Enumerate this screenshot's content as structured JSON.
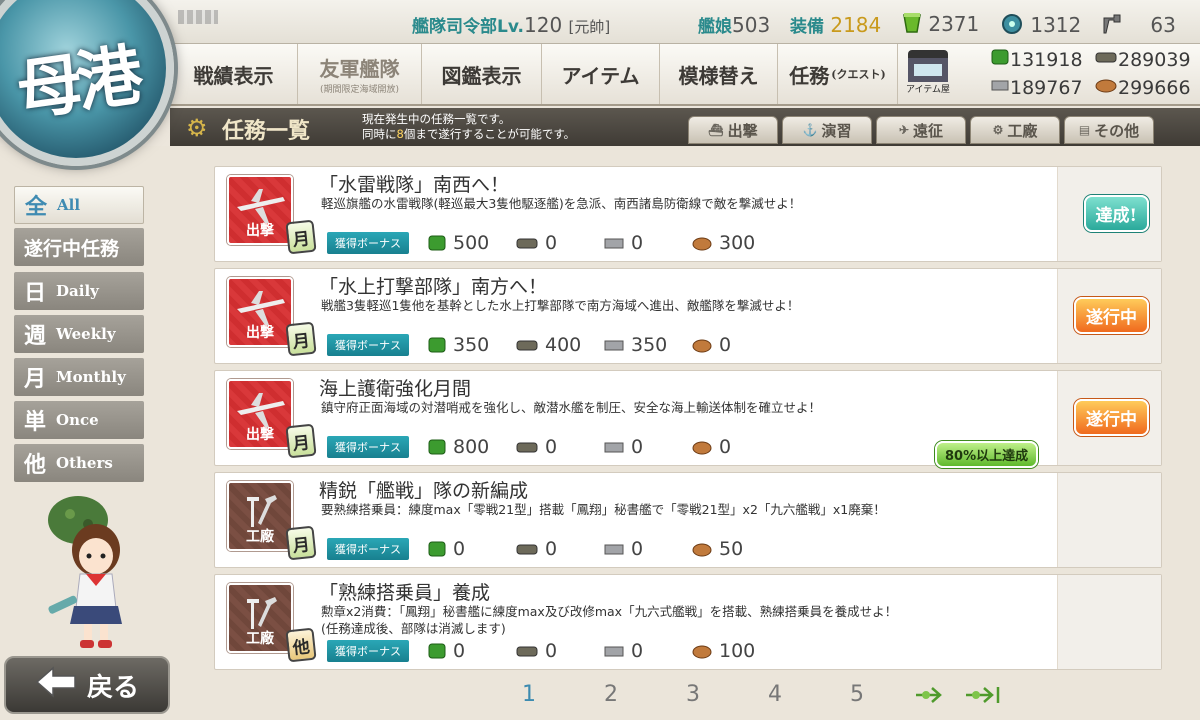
{
  "header": {
    "rank_label": "艦隊司令部Lv.",
    "level": "120",
    "rank_title": "[元帥]",
    "ships_label": "艦娘",
    "ships": "503",
    "equip_label": "装備",
    "equip": "2184",
    "bucket": "2371",
    "devmat": "1312",
    "screws": "63"
  },
  "badge": {
    "text": "母港"
  },
  "nav": {
    "record": "戦績表示",
    "friend_fleet": "友軍艦隊",
    "friend_fleet_sub": "(期間限定海域開放)",
    "album": "図鑑表示",
    "items": "アイテム",
    "remodel": "模様替え",
    "quest": "任務",
    "quest_sub": "(クエスト)",
    "shop": "アイテム屋"
  },
  "materials": {
    "fuel": "131918",
    "ammo": "289039",
    "steel": "189767",
    "bauxite": "299666"
  },
  "subheader": {
    "title": "任務一覧",
    "desc1": "現在発生中の任務一覧です。",
    "desc2_a": "同時に",
    "desc2_num": "8",
    "desc2_b": "個まで遂行することが可能です。"
  },
  "categories": [
    {
      "label": "出撃"
    },
    {
      "label": "演習"
    },
    {
      "label": "遠征"
    },
    {
      "label": "工廠"
    },
    {
      "label": "その他"
    }
  ],
  "filters": [
    {
      "k": "全",
      "label": "All"
    },
    {
      "k": "",
      "label": "遂行中任務"
    },
    {
      "k": "日",
      "label": "Daily"
    },
    {
      "k": "週",
      "label": "Weekly"
    },
    {
      "k": "月",
      "label": "Monthly"
    },
    {
      "k": "単",
      "label": "Once"
    },
    {
      "k": "他",
      "label": "Others"
    }
  ],
  "bonus_label": "獲得ボーナス",
  "quests": [
    {
      "cat": "出撃",
      "freq": "月",
      "title": "「水雷戦隊」南西へ！",
      "desc": "軽巡旗艦の水雷戦隊(軽巡最大3隻他駆逐艦)を急派、南西諸島防衛線で敵を撃滅せよ！",
      "desc2": "",
      "fuel": "500",
      "ammo": "0",
      "steel": "0",
      "bauxite": "300",
      "status": "達成!"
    },
    {
      "cat": "出撃",
      "freq": "月",
      "title": "「水上打撃部隊」南方へ！",
      "desc": "戦艦3隻軽巡1隻他を基幹とした水上打撃部隊で南方海域へ進出、敵艦隊を撃滅せよ！",
      "desc2": "",
      "fuel": "350",
      "ammo": "400",
      "steel": "350",
      "bauxite": "0",
      "status": "遂行中"
    },
    {
      "cat": "出撃",
      "freq": "月",
      "title": "海上護衛強化月間",
      "desc": "鎮守府正面海域の対潜哨戒を強化し、敵潜水艦を制圧、安全な海上輸送体制を確立せよ！",
      "desc2": "",
      "fuel": "800",
      "ammo": "0",
      "steel": "0",
      "bauxite": "0",
      "status": "遂行中",
      "progress": "80%以上達成"
    },
    {
      "cat": "工廠",
      "freq": "月",
      "title": "精鋭「艦戦」隊の新編成",
      "desc": "要熟練搭乗員：練度max「零戦21型」搭載「鳳翔」秘書艦で「零戦21型」x2「九六艦戦」x1廃棄！",
      "desc2": "",
      "fuel": "0",
      "ammo": "0",
      "steel": "0",
      "bauxite": "50",
      "status": ""
    },
    {
      "cat": "工廠",
      "freq": "他",
      "title": "「熟練搭乗員」養成",
      "desc": "勲章x2消費：「鳳翔」秘書艦に練度max及び改修max「九六式艦戦」を搭載、熟練搭乗員を養成せよ！",
      "desc2": "(任務達成後、部隊は消滅します)",
      "fuel": "0",
      "ammo": "0",
      "steel": "0",
      "bauxite": "100",
      "status": ""
    }
  ],
  "pagination": {
    "pages": [
      "1",
      "2",
      "3",
      "4",
      "5"
    ],
    "current": "1"
  },
  "back": {
    "label": "戻る"
  },
  "colors": {
    "accent": "#2a8a8c",
    "sortie": "#d9383a",
    "arsenal": "#7b4f43",
    "done": "#2aa99b",
    "progress": "#f06a1e"
  }
}
